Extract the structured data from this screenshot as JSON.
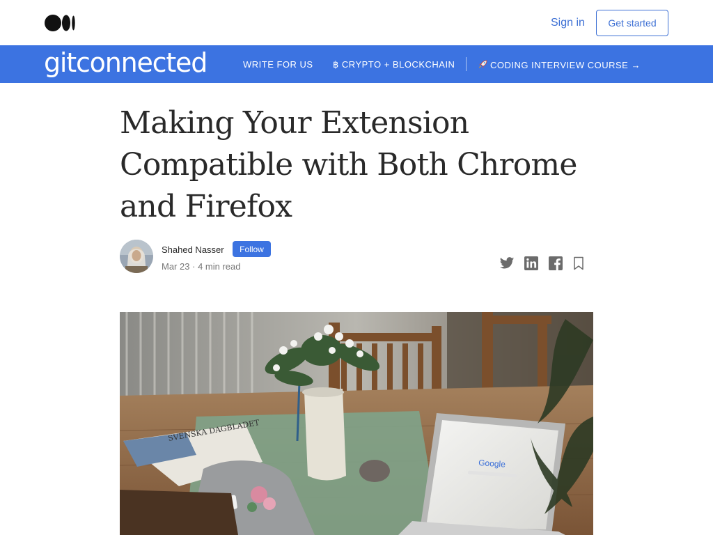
{
  "topbar": {
    "logo": "medium-logo-icon",
    "signin_label": "Sign in",
    "getstarted_label": "Get started"
  },
  "publication": {
    "name": "gitconnected",
    "nav": [
      {
        "label": "WRITE FOR US",
        "icon": ""
      },
      {
        "label": "CRYPTO + BLOCKCHAIN",
        "icon": "bitcoin-icon"
      },
      {
        "label": "CODING INTERVIEW COURSE →",
        "icon": "rocket-icon"
      }
    ]
  },
  "article": {
    "title": "Making Your Extension Compatible with Both Chrome and Firefox",
    "author": "Shahed Nasser",
    "follow_label": "Follow",
    "date": "Mar 23",
    "separator": "·",
    "read_time": "4 min read",
    "share_icons": [
      "twitter-icon",
      "linkedin-icon",
      "facebook-icon",
      "bookmark-icon"
    ]
  },
  "hero": {
    "newspaper_text": "SVENSKA DAGBLADET",
    "screen_brand": "Google"
  },
  "colors": {
    "accent": "#3c73e1",
    "link": "#3c6fd4",
    "text": "#292929",
    "muted": "#757575"
  }
}
